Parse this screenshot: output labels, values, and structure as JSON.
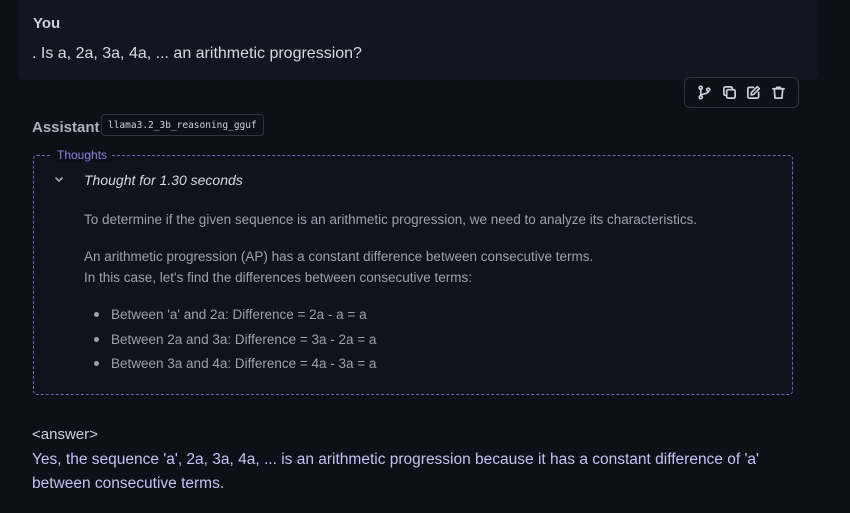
{
  "user": {
    "name": "You",
    "message": ". Is a, 2a, 3a, 4a, ... an arithmetic progression?"
  },
  "toolbar": {
    "icons": [
      "branch-icon",
      "copy-icon",
      "edit-icon",
      "trash-icon"
    ]
  },
  "assistant": {
    "name": "Assistant",
    "model": "llama3.2_3b_reasoning_gguf"
  },
  "thoughts": {
    "legend": "Thoughts",
    "duration_label": "Thought for 1.30 seconds",
    "paragraph1": "To determine if the given sequence is an arithmetic progression, we need to analyze its characteristics.",
    "paragraph2_line1": "An arithmetic progression (AP) has a constant difference between consecutive terms.",
    "paragraph2_line2": "In this case, let's find the differences between consecutive terms:",
    "bullets": [
      "Between 'a' and 2a: Difference = 2a - a = a",
      "Between 2a and 3a: Difference = 3a - 2a = a",
      "Between 3a and 4a: Difference = 4a - 3a = a"
    ]
  },
  "answer": {
    "tag": "<answer>",
    "text": "Yes, the sequence 'a', 2a, 3a, 4a, ... is an arithmetic progression because it has a constant difference of 'a' between consecutive terms."
  },
  "colors": {
    "background": "#0d1117",
    "thoughts_border": "#6e64b8",
    "answer_text": "#c3c1f5"
  }
}
